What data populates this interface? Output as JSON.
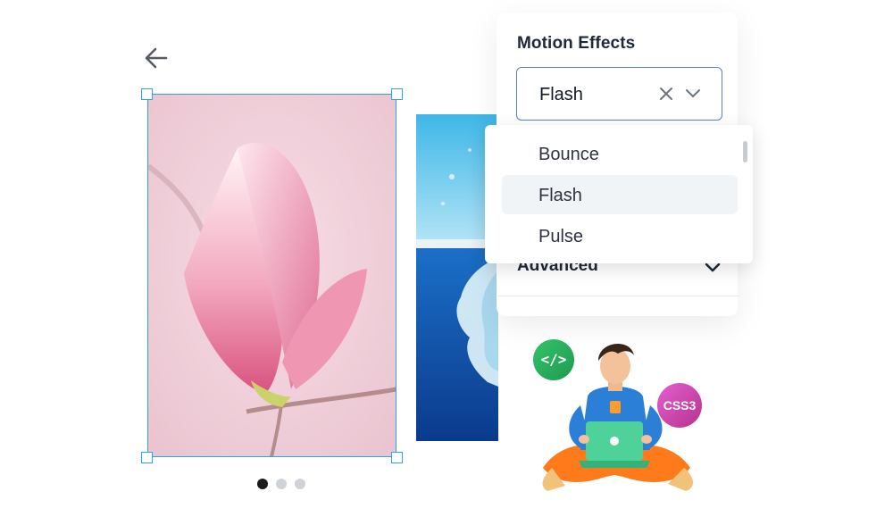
{
  "panel": {
    "title": "Motion Effects",
    "select": {
      "value": "Flash",
      "clear_icon": "close-icon",
      "chevron_icon": "chevron-down-icon"
    },
    "dropdown": {
      "options": [
        "Bounce",
        "Flash",
        "Pulse"
      ],
      "selected": "Flash"
    },
    "advanced": {
      "label": "Advanced",
      "icon": "chevron-down-icon"
    }
  },
  "carousel": {
    "slides": [
      "magnolia-flower-image",
      "ocean-iceberg-image"
    ],
    "dots": 3,
    "active_dot": 0
  },
  "illustration": {
    "code_badge": "</>",
    "css_badge": "CSS3"
  },
  "colors": {
    "selection_border": "#2aa6e8",
    "select_border": "#5d80b5",
    "selected_option_bg": "#f1f4f7",
    "code_badge": "#2bb15f",
    "css_badge": "#c9429f"
  }
}
